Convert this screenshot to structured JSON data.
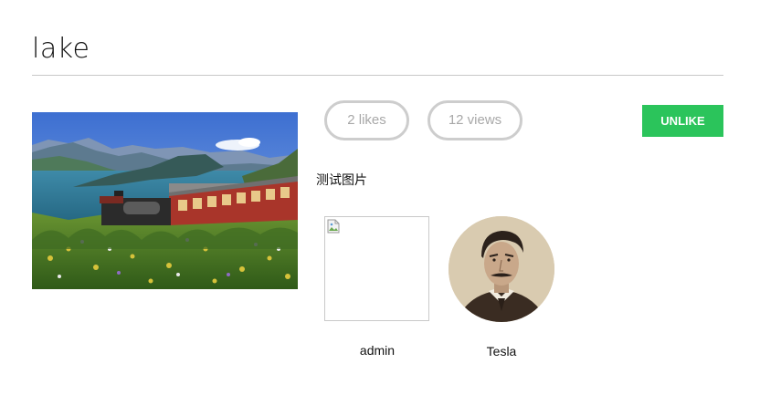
{
  "post": {
    "title": "lake",
    "description": "测试图片"
  },
  "stats": {
    "likes_label": "2 likes",
    "views_label": "12 views"
  },
  "actions": {
    "unlike_label": "UNLIKE",
    "unlike_color": "#2bc45b"
  },
  "users": [
    {
      "name": "admin",
      "avatar": "broken-image-icon"
    },
    {
      "name": "Tesla",
      "avatar": "portrait"
    }
  ]
}
